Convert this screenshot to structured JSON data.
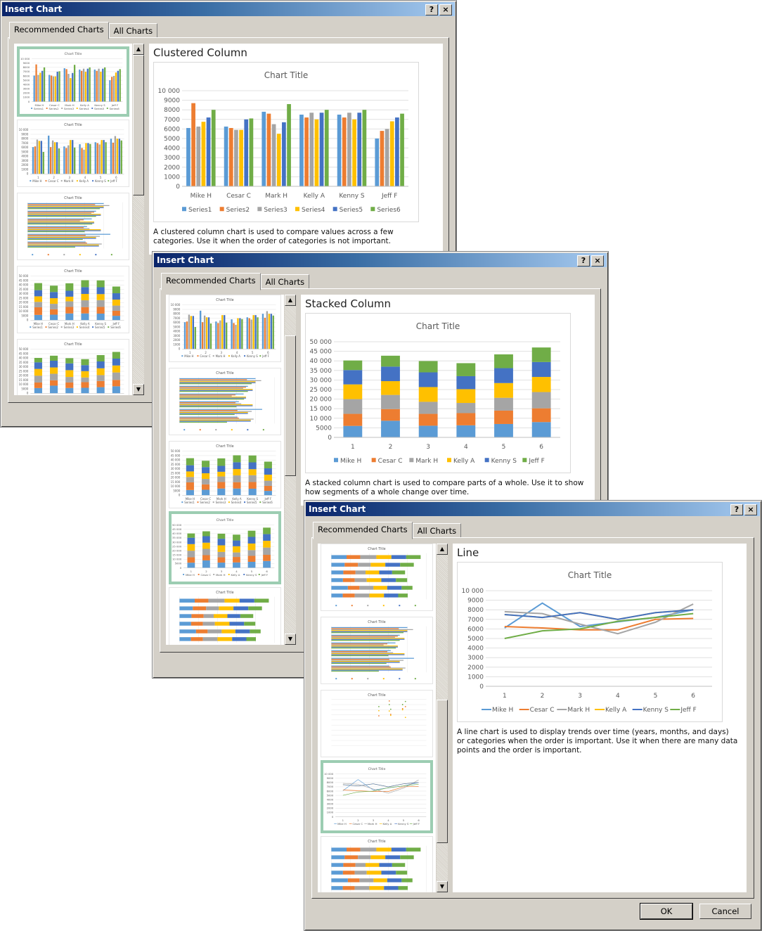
{
  "dialogs": [
    {
      "title": "Insert Chart",
      "help_label": "?",
      "close_label": "×",
      "tabs": [
        "Recommended Charts",
        "All Charts"
      ],
      "active_tab": 0,
      "preview_title": "Clustered Column",
      "description": "A clustered column chart is used to compare values across a few categories. Use it when the order of categories is not important."
    },
    {
      "title": "Insert Chart",
      "help_label": "?",
      "close_label": "×",
      "tabs": [
        "Recommended Charts",
        "All Charts"
      ],
      "active_tab": 0,
      "preview_title": "Stacked Column",
      "description": "A stacked column chart is used to compare parts of a whole. Use it to show how segments of a whole change over time."
    },
    {
      "title": "Insert Chart",
      "help_label": "?",
      "close_label": "×",
      "tabs": [
        "Recommended Charts",
        "All Charts"
      ],
      "active_tab": 0,
      "preview_title": "Line",
      "description": "A line chart is used to display trends over time (years, months, and days) or categories when the order is important. Use it when there are many data points and the order is important.",
      "ok_label": "OK",
      "cancel_label": "Cancel"
    }
  ],
  "icons": {
    "scroll_up": "▲",
    "scroll_down": "▼"
  },
  "colors": {
    "series": [
      "#5B9BD5",
      "#ED7D31",
      "#A5A5A5",
      "#FFC000",
      "#4472C4",
      "#70AD47"
    ],
    "selection": "#9CCDB2"
  },
  "chart_data": [
    {
      "type": "bar",
      "title": "Chart Title",
      "categories": [
        "Mike H",
        "Cesar C",
        "Mark H",
        "Kelly A",
        "Kenny S",
        "Jeff F"
      ],
      "series": [
        {
          "name": "Series1",
          "values": [
            6100,
            6250,
            7800,
            7500,
            7500,
            5000
          ]
        },
        {
          "name": "Series2",
          "values": [
            8700,
            6100,
            7600,
            7200,
            7200,
            5800
          ]
        },
        {
          "name": "Series3",
          "values": [
            6250,
            5900,
            6500,
            7700,
            7700,
            6000
          ]
        },
        {
          "name": "Series4",
          "values": [
            6750,
            5900,
            5500,
            7000,
            7000,
            6800
          ]
        },
        {
          "name": "Series5",
          "values": [
            7200,
            7000,
            6700,
            7700,
            7700,
            7200
          ]
        },
        {
          "name": "Series6",
          "values": [
            8000,
            7100,
            8600,
            8000,
            8000,
            7600
          ]
        }
      ],
      "yticks": [
        "0",
        "1000",
        "2000",
        "3000",
        "4000",
        "5000",
        "6000",
        "7000",
        "8000",
        "9000",
        "10 000"
      ],
      "ylim": [
        0,
        10000
      ],
      "legend": "bottom",
      "grid": true
    },
    {
      "type": "bar",
      "stacked": true,
      "title": "Chart Title",
      "categories": [
        "1",
        "2",
        "3",
        "4",
        "5",
        "6"
      ],
      "series": [
        {
          "name": "Mike H",
          "values": [
            6000,
            8700,
            6100,
            6300,
            7000,
            8000
          ]
        },
        {
          "name": "Cesar C",
          "values": [
            6300,
            6100,
            6200,
            6400,
            7000,
            7200
          ]
        },
        {
          "name": "Mark H",
          "values": [
            7700,
            7400,
            6300,
            5300,
            6700,
            8500
          ]
        },
        {
          "name": "Kelly A",
          "values": [
            7700,
            7200,
            7700,
            7200,
            7700,
            7900
          ]
        },
        {
          "name": "Kenny S",
          "values": [
            7500,
            7600,
            7700,
            6800,
            7800,
            7800
          ]
        },
        {
          "name": "Jeff F",
          "values": [
            5000,
            5700,
            5900,
            6800,
            7200,
            7600
          ]
        }
      ],
      "yticks": [
        "0",
        "5000",
        "10 000",
        "15 000",
        "20 000",
        "25 000",
        "30 000",
        "35 000",
        "40 000",
        "45 000",
        "50 000"
      ],
      "ylim": [
        0,
        50000
      ],
      "legend": "bottom",
      "grid": true
    },
    {
      "type": "line",
      "title": "Chart Title",
      "categories": [
        "1",
        "2",
        "3",
        "4",
        "5",
        "6"
      ],
      "series": [
        {
          "name": "Mike H",
          "values": [
            6100,
            8700,
            6250,
            6750,
            7200,
            8000
          ]
        },
        {
          "name": "Cesar C",
          "values": [
            6250,
            6100,
            5900,
            5900,
            7000,
            7100
          ]
        },
        {
          "name": "Mark H",
          "values": [
            7800,
            7600,
            6500,
            5500,
            6700,
            8600
          ]
        },
        {
          "name": "Kelly A",
          "values": [
            7500,
            7200,
            7700,
            7000,
            7700,
            8000
          ]
        },
        {
          "name": "Kenny S",
          "values": [
            7500,
            7200,
            7700,
            7000,
            7700,
            8000
          ]
        },
        {
          "name": "Jeff F",
          "values": [
            5000,
            5800,
            6000,
            6800,
            7200,
            7600
          ]
        }
      ],
      "yticks": [
        "0",
        "1000",
        "2000",
        "3000",
        "4000",
        "5000",
        "6000",
        "7000",
        "8000",
        "9000",
        "10 000"
      ],
      "ylim": [
        0,
        10000
      ],
      "legend": "bottom",
      "grid": true
    }
  ]
}
